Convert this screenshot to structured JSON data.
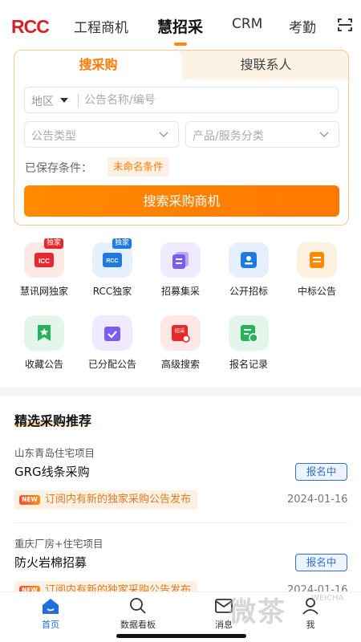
{
  "brand": {
    "logo_text": "RCC",
    "logo_color": "#d71f26"
  },
  "top_nav": {
    "tabs": [
      {
        "label": "工程商机"
      },
      {
        "label": "慧招采"
      },
      {
        "label": "CRM"
      },
      {
        "label": "考勤"
      }
    ],
    "active_index": 1,
    "scan_icon": "scan-icon"
  },
  "search_card": {
    "tabs": [
      {
        "label": "搜采购"
      },
      {
        "label": "搜联系人"
      }
    ],
    "active_tab": 0,
    "region_label": "地区",
    "search_placeholder": "公告名称/编号",
    "search_value": "",
    "select_notice_type": "公告类型",
    "select_category": "产品/服务分类",
    "saved_label": "已保存条件：",
    "saved_chip": "未命名条件",
    "submit_label": "搜索采购商机"
  },
  "grid": {
    "items": [
      {
        "label": "慧讯网独家",
        "icon": "icc-exclusive-icon",
        "badge": "独家",
        "color": "#e8262b",
        "bg": "#fde8e8"
      },
      {
        "label": "RCC独家",
        "icon": "rcc-exclusive-icon",
        "badge": "独家",
        "color": "#1f7ae0",
        "bg": "#e6f0fd"
      },
      {
        "label": "招募集采",
        "icon": "stack-icon",
        "badge": "",
        "color": "#7b5cf0",
        "bg": "#efeafd"
      },
      {
        "label": "公开招标",
        "icon": "public-tender-icon",
        "badge": "",
        "color": "#1f7ae0",
        "bg": "#e6f0fd"
      },
      {
        "label": "中标公告",
        "icon": "award-notice-icon",
        "badge": "",
        "color": "#ff8a00",
        "bg": "#fff1e0"
      },
      {
        "label": "收藏公告",
        "icon": "star-bookmark-icon",
        "badge": "",
        "color": "#27b35a",
        "bg": "#e4f6ea"
      },
      {
        "label": "已分配公告",
        "icon": "assigned-icon",
        "badge": "",
        "color": "#7b5cf0",
        "bg": "#efeafd"
      },
      {
        "label": "高级搜索",
        "icon": "advanced-search-icon",
        "badge": "招采",
        "color": "#e8262b",
        "bg": "#fde8e8"
      },
      {
        "label": "报名记录",
        "icon": "signup-record-icon",
        "badge": "",
        "color": "#27b35a",
        "bg": "#e4f6ea"
      }
    ]
  },
  "recommend": {
    "title": "精选采购推荐",
    "items": [
      {
        "region": "山东青岛住宅项目",
        "name": "GRG线条采购",
        "status": "报名中",
        "new_tag": "NEW",
        "notice": "订阅内有新的独家采购公告发布",
        "date": "2024-01-16"
      },
      {
        "region": "重庆厂房+住宅项目",
        "name": "防火岩棉招募",
        "status": "报名中",
        "new_tag": "NEW",
        "notice": "订阅内有新的独家采购公告发布",
        "date": "2024-01-16"
      }
    ]
  },
  "tabbar": {
    "items": [
      {
        "label": "首页",
        "icon": "home-icon"
      },
      {
        "label": "数据看板",
        "icon": "search-icon"
      },
      {
        "label": "消息",
        "icon": "mail-icon"
      },
      {
        "label": "我",
        "icon": "person-icon"
      }
    ],
    "active_index": 0,
    "active_color": "#1f6fe0"
  },
  "watermark": {
    "text": "微茶",
    "sub": "WEICHA"
  }
}
